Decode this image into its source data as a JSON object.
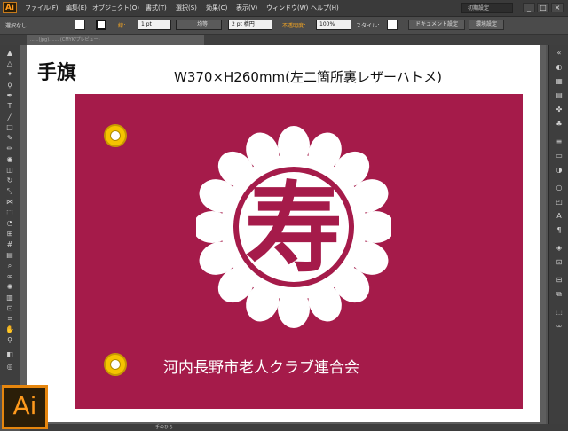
{
  "app": {
    "logo": "Ai",
    "menu": [
      "ファイル(F)",
      "編集(E)",
      "オブジェクト(O)",
      "書式(T)",
      "選択(S)",
      "効果(C)",
      "表示(V)",
      "ウィンドウ(W)",
      "ヘルプ(H)"
    ],
    "workspace": "初期設定",
    "window_controls": [
      "_",
      "□",
      "×"
    ]
  },
  "control": {
    "selection": "選択なし",
    "stroke_label": "線：",
    "stroke_weight": "1 pt",
    "profile": "均等",
    "brush": "2 pt 楕円",
    "opacity_label": "不透明度：",
    "opacity": "100%",
    "style_label": "スタイル：",
    "doc_setup": "ドキュメント設定",
    "preferences": "環境設定"
  },
  "doc_tab": "......(jpg)....... (CMYK/プレビュー)",
  "artwork": {
    "title": "手旗",
    "spec": "W370×H260mm(左二箇所裏レザーハトメ)",
    "flag_color": "#a51b4a",
    "emblem_char": "寿",
    "org_name": "河内長野市老人クラブ連合会"
  },
  "status": {
    "tool": "手のひら"
  },
  "badge": "Ai"
}
